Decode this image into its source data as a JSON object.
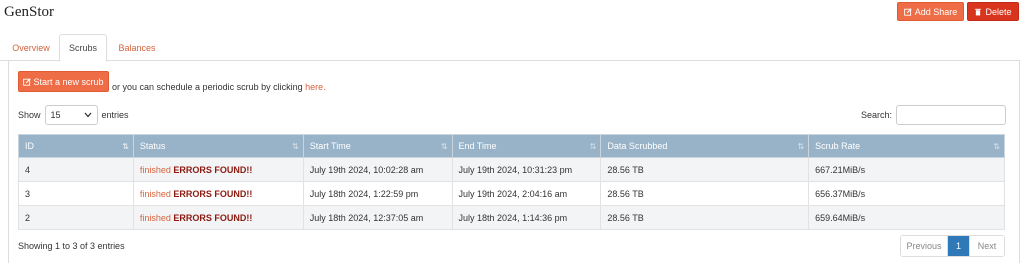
{
  "app": {
    "title": "GenStor"
  },
  "header": {
    "add_share_label": "Add Share",
    "delete_label": "Delete"
  },
  "tabs": [
    {
      "label": "Overview"
    },
    {
      "label": "Scrubs"
    },
    {
      "label": "Balances"
    }
  ],
  "scrubs": {
    "start_label": "Start a new scrub",
    "note_text": "or you can schedule a periodic scrub by clicking",
    "note_link": "here."
  },
  "controls": {
    "show_label": "Show",
    "entries_value": "15",
    "entries_label": "entries",
    "search_label": "Search:",
    "search_value": ""
  },
  "table": {
    "columns": [
      "ID",
      "Status",
      "Start Time",
      "End Time",
      "Data Scrubbed",
      "Scrub Rate"
    ],
    "rows": [
      {
        "id": "4",
        "status_word": "finished",
        "status_flag": "ERRORS FOUND!!",
        "start": "July 19th 2024, 10:02:28 am",
        "end": "July 19th 2024, 10:31:23 pm",
        "data": "28.56 TB",
        "rate": "667.21MiB/s"
      },
      {
        "id": "3",
        "status_word": "finished",
        "status_flag": "ERRORS FOUND!!",
        "start": "July 18th 2024, 1:22:59 pm",
        "end": "July 19th 2024, 2:04:16 am",
        "data": "28.56 TB",
        "rate": "656.37MiB/s"
      },
      {
        "id": "2",
        "status_word": "finished",
        "status_flag": "ERRORS FOUND!!",
        "start": "July 18th 2024, 12:37:05 am",
        "end": "July 18th 2024, 1:14:36 pm",
        "data": "28.56 TB",
        "rate": "659.64MiB/s"
      }
    ]
  },
  "footer": {
    "info": "Showing 1 to 3 of 3 entries",
    "prev_label": "Previous",
    "page_label": "1",
    "next_label": "Next"
  },
  "colors": {
    "accent": "#ee6d47",
    "danger": "#d9341d",
    "table_header": "#98b3c8",
    "active_page": "#2f79b9"
  },
  "icons": {
    "add_share": "edit-icon",
    "delete": "trash-icon",
    "start_scrub": "edit-icon",
    "select": "chevron-down-icon",
    "sort": "sort-icon"
  }
}
